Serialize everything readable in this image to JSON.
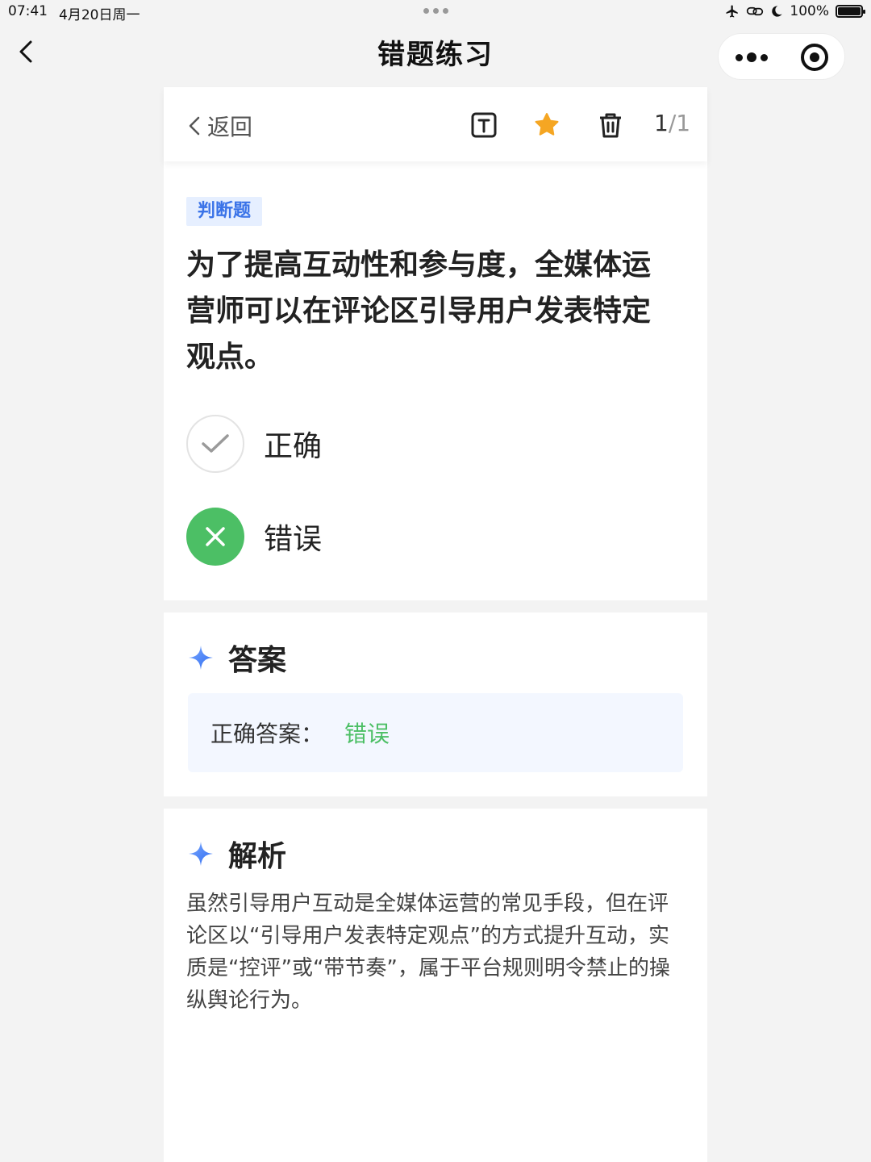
{
  "status_bar": {
    "time": "07:41",
    "date": "4月20日周一",
    "battery": "100%",
    "battery_level": 1.0
  },
  "nav": {
    "title": "错题练习",
    "icons": [
      "back-chevron-icon",
      "more-dots-icon",
      "target-icon"
    ]
  },
  "toolbar": {
    "back_label": "返回",
    "current": "1",
    "separator": "/",
    "total": "1",
    "icons": [
      "text-size-icon",
      "star-icon",
      "trash-icon"
    ],
    "star_color": "#f5a623"
  },
  "question": {
    "type": "判断题",
    "text": "为了提高互动性和参与度，全媒体运营师可以在评论区引导用户发表特定观点。",
    "options": [
      {
        "label": "正确",
        "state": "unselected",
        "icon": "check-icon"
      },
      {
        "label": "错误",
        "state": "selected",
        "icon": "cross-icon"
      }
    ]
  },
  "answer": {
    "title": "答案",
    "label": "正确答案：",
    "value": "错误"
  },
  "analysis": {
    "title": "解析",
    "text": "虽然引导用户互动是全媒体运营的常见手段，但在评论区以“引导用户发表特定观点”的方式提升互动，实质是“控评”或“带节奏”，属于平台规则明令禁止的操纵舆论行为。"
  },
  "colors": {
    "accent_blue": "#3a73e8",
    "correct_green": "#4cbf65",
    "background": "#f3f3f3"
  }
}
